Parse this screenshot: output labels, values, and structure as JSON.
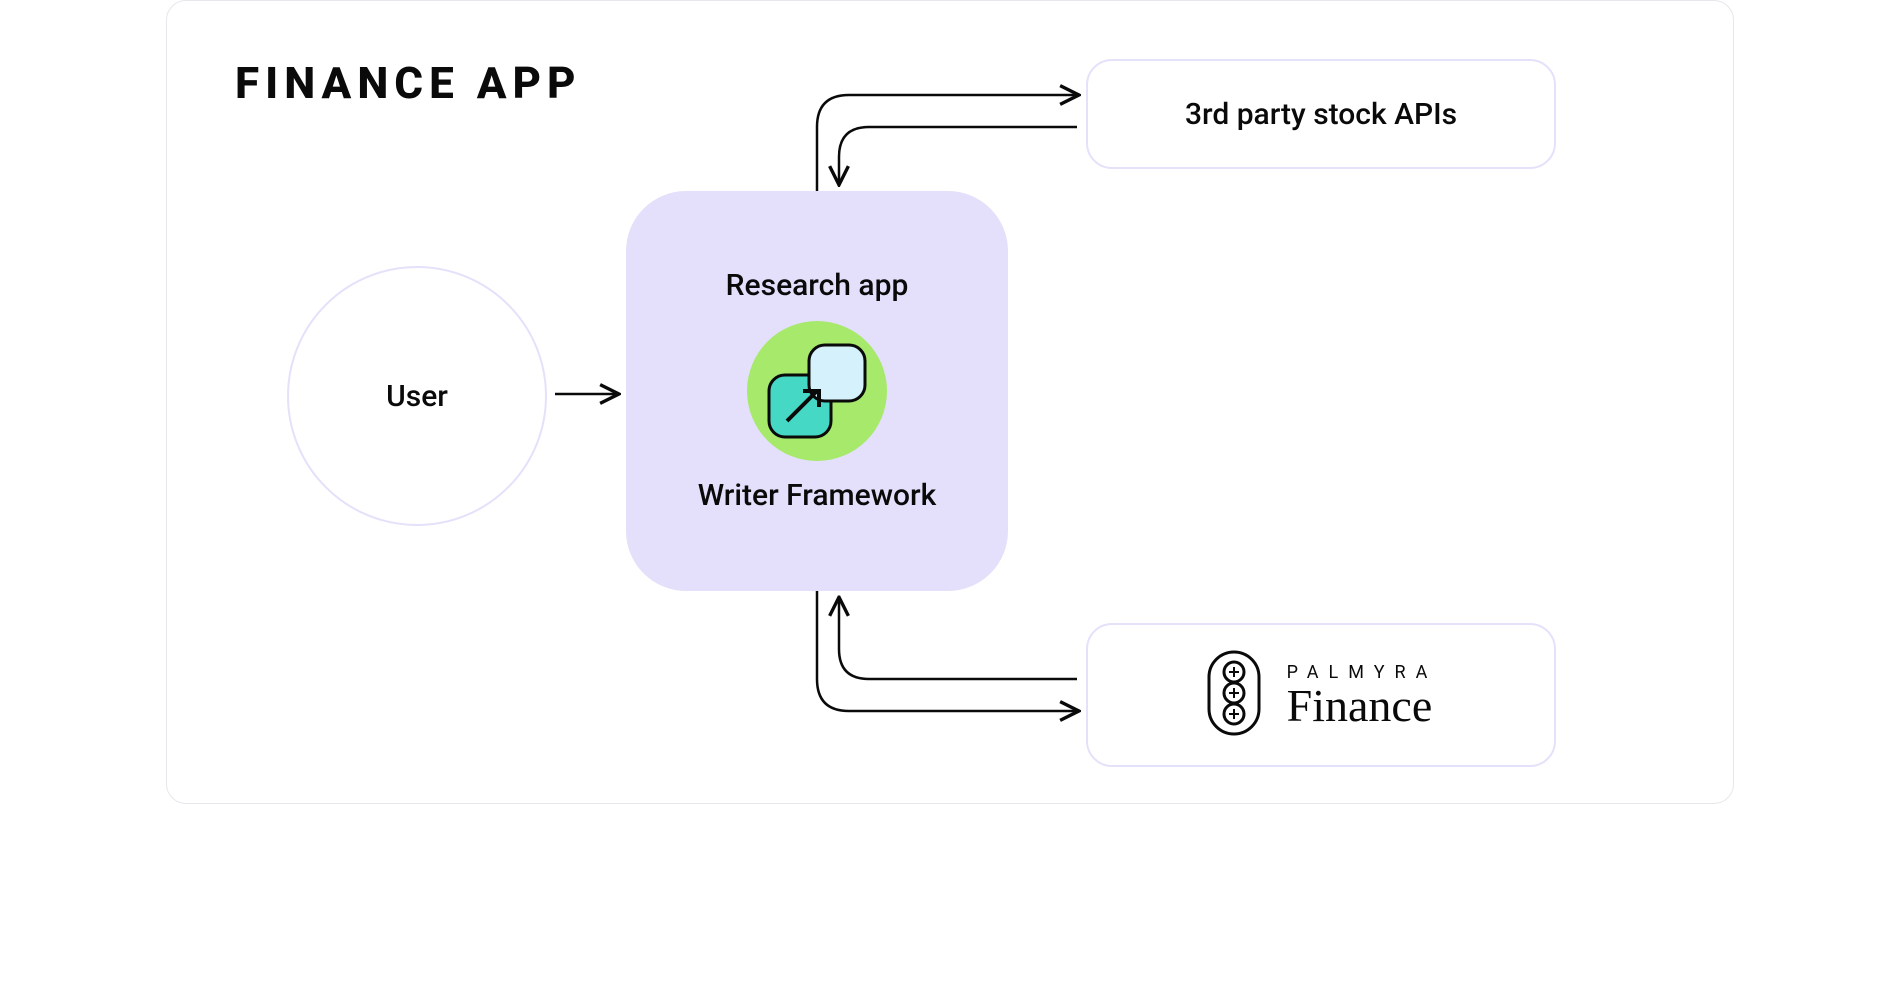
{
  "title": "FINANCE APP",
  "nodes": {
    "user": {
      "label": "User"
    },
    "research_app": {
      "top_label": "Research app",
      "bottom_label": "Writer Framework"
    },
    "stock_apis": {
      "label": "3rd party stock APIs"
    },
    "palmyra": {
      "top_label": "PALMYRA",
      "bottom_label": "Finance"
    }
  },
  "connectors": {
    "user_to_app": "unidirectional",
    "app_to_stock_apis": "bidirectional",
    "app_to_palmyra": "bidirectional"
  }
}
